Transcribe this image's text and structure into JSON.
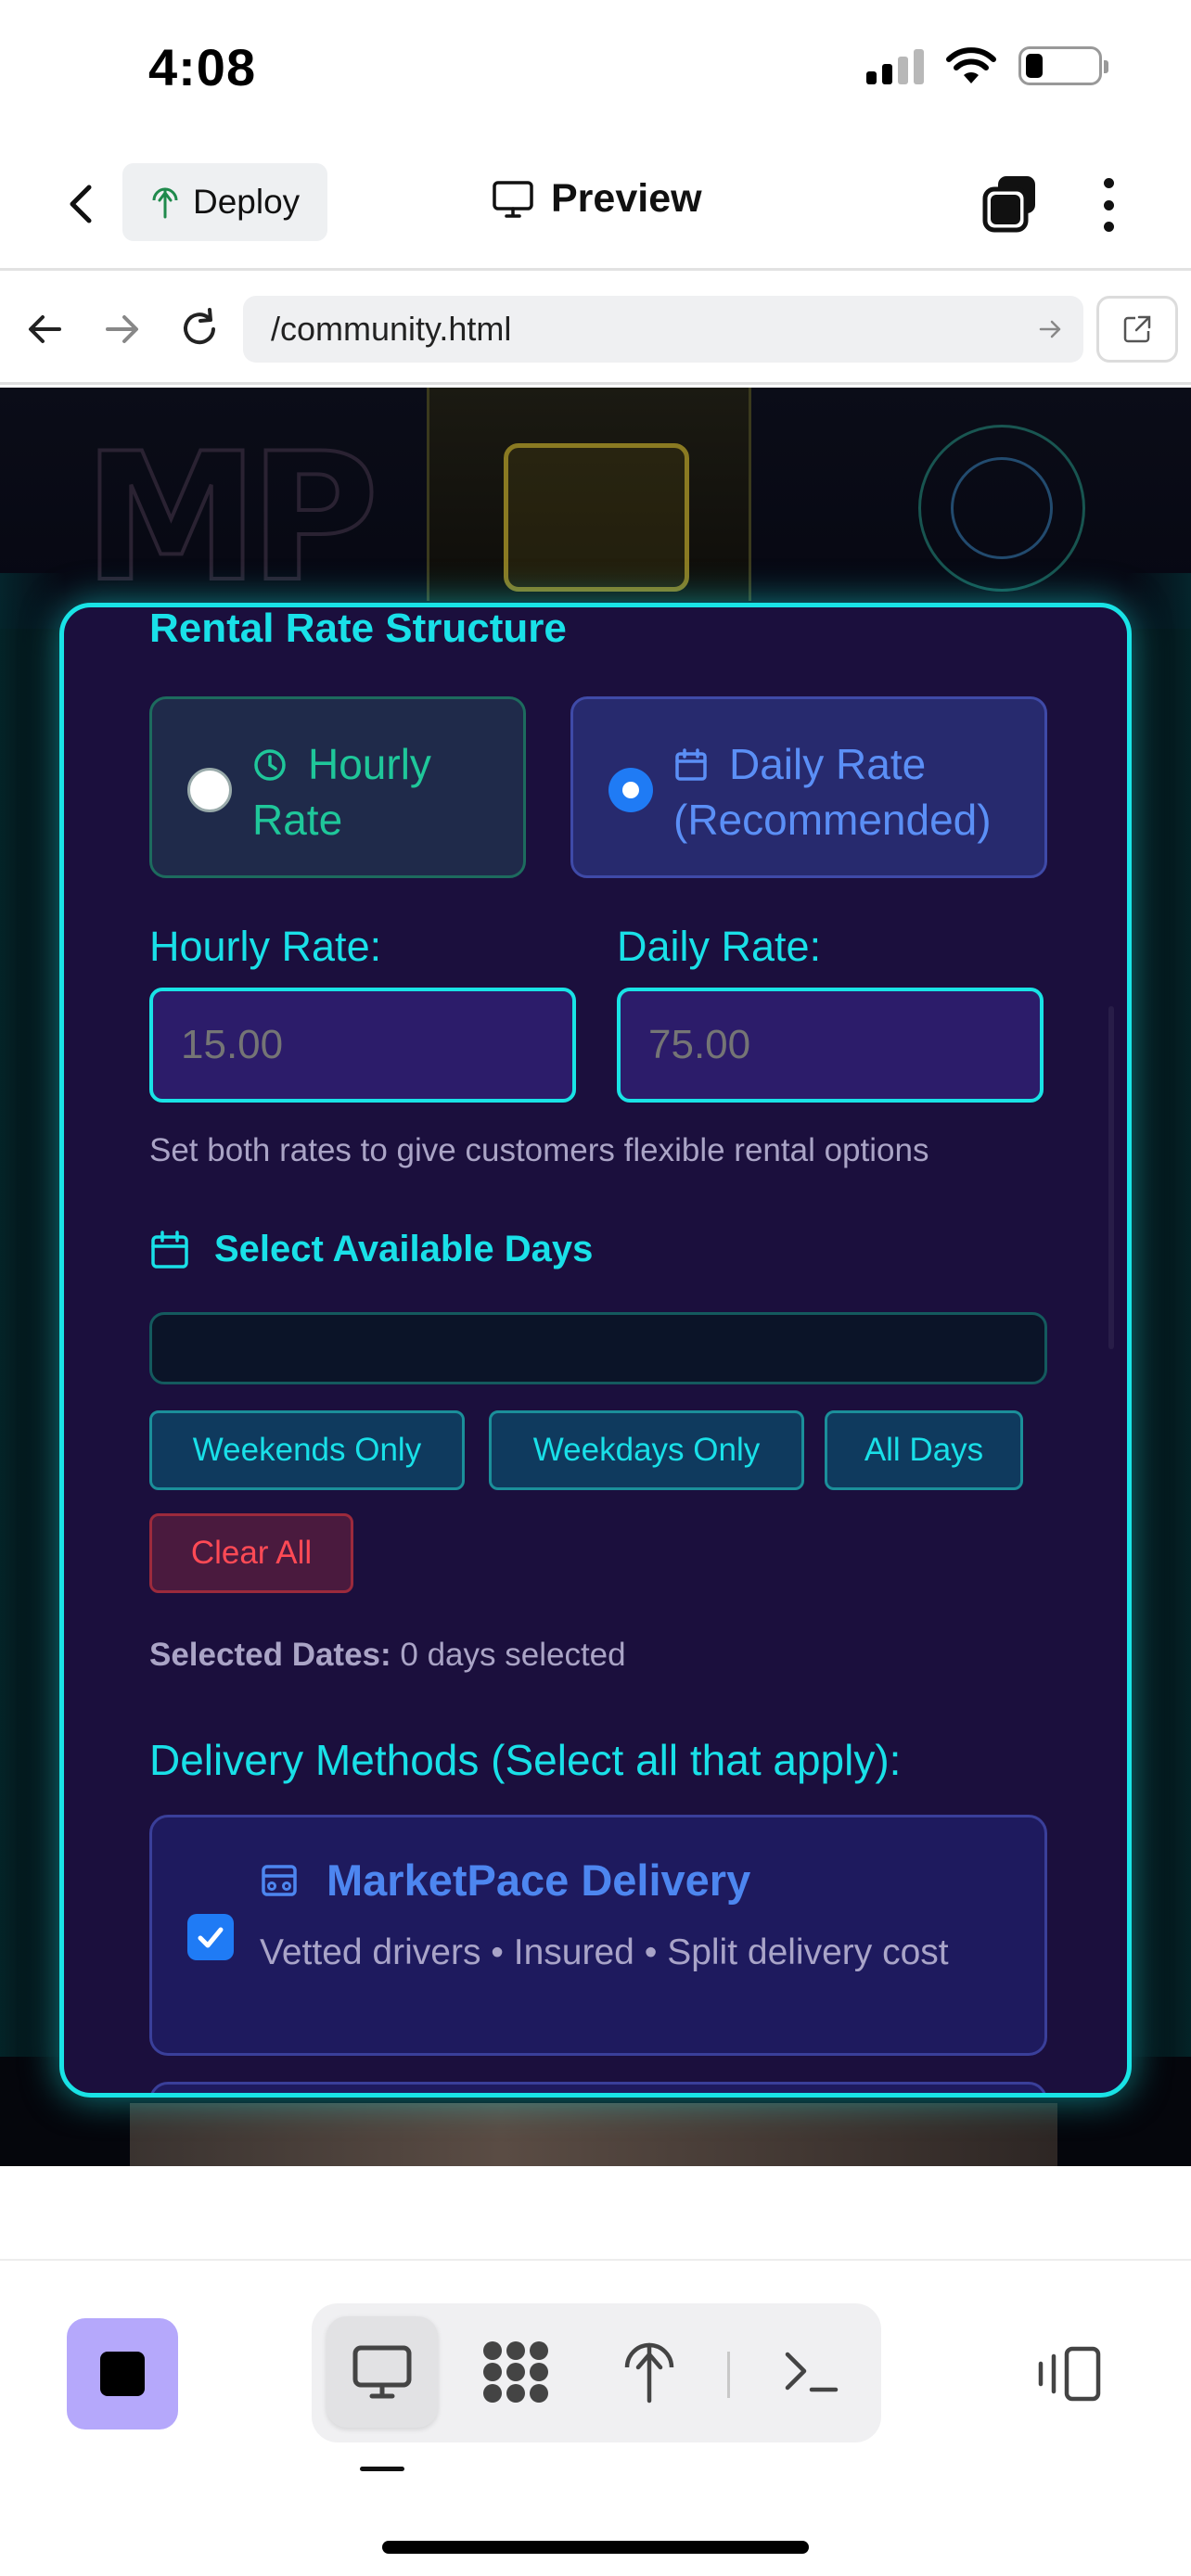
{
  "status_bar": {
    "time": "4:08"
  },
  "app_header": {
    "deploy_label": "Deploy",
    "preview_label": "Preview"
  },
  "browser": {
    "url": "/community.html"
  },
  "rental_form": {
    "section_title": "Rental Rate Structure",
    "options": {
      "hourly": {
        "line1": "Hourly",
        "line2": "Rate",
        "selected": false
      },
      "daily": {
        "line1": "Daily Rate",
        "line2": "(Recommended)",
        "selected": true
      }
    },
    "hourly_rate": {
      "label": "Hourly Rate:",
      "placeholder": "15.00"
    },
    "daily_rate": {
      "label": "Daily Rate:",
      "placeholder": "75.00"
    },
    "helper_text": "Set both rates to give customers flexible rental options",
    "days": {
      "title": "Select Available Days",
      "chips": [
        "Weekends Only",
        "Weekdays Only",
        "All Days"
      ],
      "clear_label": "Clear All",
      "selected_label": "Selected Dates:",
      "selected_value": "0 days selected"
    },
    "delivery": {
      "title": "Delivery Methods (Select all that apply):",
      "option_name": "MarketPace Delivery",
      "option_desc": "Vetted drivers • Insured • Split delivery cost",
      "checked": true
    }
  },
  "colors": {
    "accent_cyan": "#19e3e6",
    "card_bg": "#1b0f3d",
    "selected_blue": "#1f7bf5",
    "hourly_green": "#1fc79a",
    "clear_red": "#ff4a55",
    "stop_purple": "#b5a8fb"
  },
  "toolbar": {
    "icons": [
      "stop-icon",
      "monitor-icon",
      "apps-grid-icon",
      "deploy-icon",
      "terminal-icon",
      "layout-icon"
    ],
    "active": "monitor-icon"
  }
}
